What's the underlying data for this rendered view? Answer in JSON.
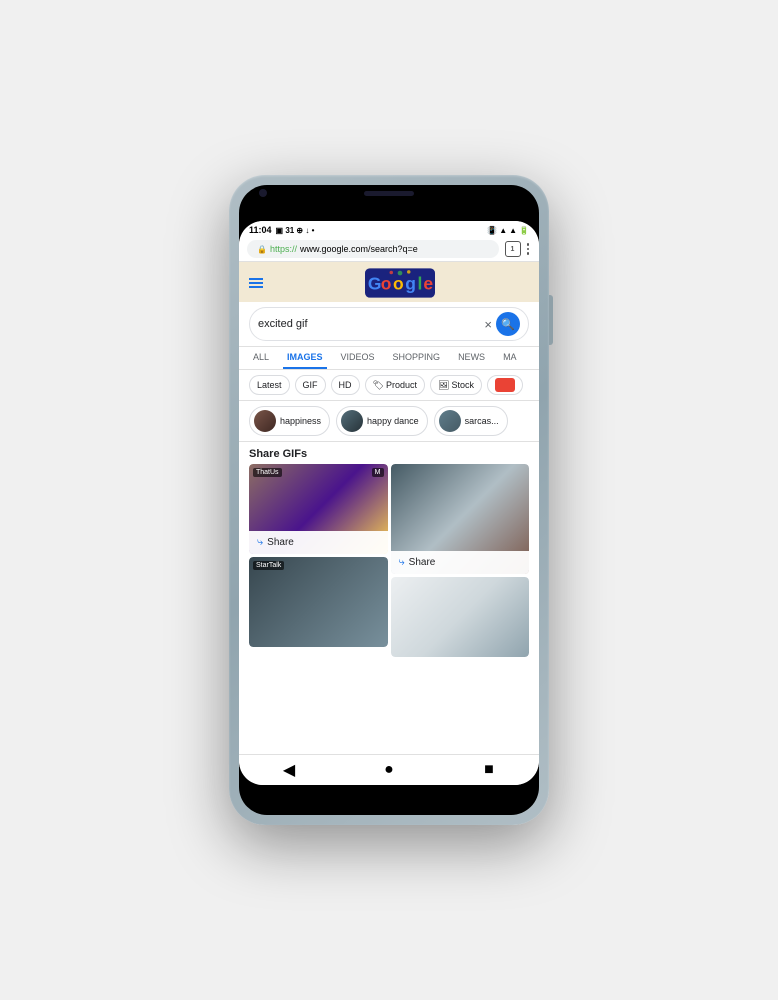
{
  "phone": {
    "status_bar": {
      "time": "11:04",
      "icons_left": [
        "sim",
        "31",
        "location",
        "download",
        "dot"
      ],
      "icons_right": [
        "vibrate",
        "wifi",
        "signal",
        "battery"
      ]
    },
    "url_bar": {
      "lock_icon": "🔒",
      "url_https": "https://",
      "url_domain": "www.google.com/search?q=e",
      "tab_count": "1"
    },
    "google_header": {
      "hamburger_label": "menu",
      "logo_text": "Google"
    },
    "search": {
      "query": "excited gif",
      "clear_label": "×",
      "search_button_icon": "🔍"
    },
    "tabs": [
      {
        "label": "ALL",
        "active": false
      },
      {
        "label": "IMAGES",
        "active": true
      },
      {
        "label": "VIDEOS",
        "active": false
      },
      {
        "label": "SHOPPING",
        "active": false
      },
      {
        "label": "NEWS",
        "active": false
      },
      {
        "label": "MA",
        "active": false
      }
    ],
    "filter_chips": [
      {
        "label": "Latest",
        "active": false
      },
      {
        "label": "GIF",
        "active": false
      },
      {
        "label": "HD",
        "active": false
      },
      {
        "label": "Product",
        "active": false,
        "icon": "tag"
      },
      {
        "label": "Stock",
        "active": false,
        "icon": "image"
      },
      {
        "label": "",
        "active": false,
        "is_color": true
      }
    ],
    "related_chips": [
      {
        "label": "happiness"
      },
      {
        "label": "happy dance"
      },
      {
        "label": "sarcas..."
      }
    ],
    "section": {
      "title": "Share GIFs"
    },
    "gifs": [
      {
        "col": 0,
        "items": [
          {
            "label_left": "ThatUs",
            "label_right": "M",
            "has_share": true,
            "height": "tall"
          },
          {
            "label_left": "StarTalk",
            "has_share": false,
            "height": "tall"
          }
        ]
      },
      {
        "col": 1,
        "items": [
          {
            "has_share": true,
            "height": "tall"
          },
          {
            "has_share": false,
            "height": "medium"
          }
        ]
      }
    ],
    "share_label": "Share",
    "nav_buttons": [
      {
        "label": "back",
        "icon": "◀"
      },
      {
        "label": "home",
        "icon": "●"
      },
      {
        "label": "recents",
        "icon": "■"
      }
    ]
  }
}
